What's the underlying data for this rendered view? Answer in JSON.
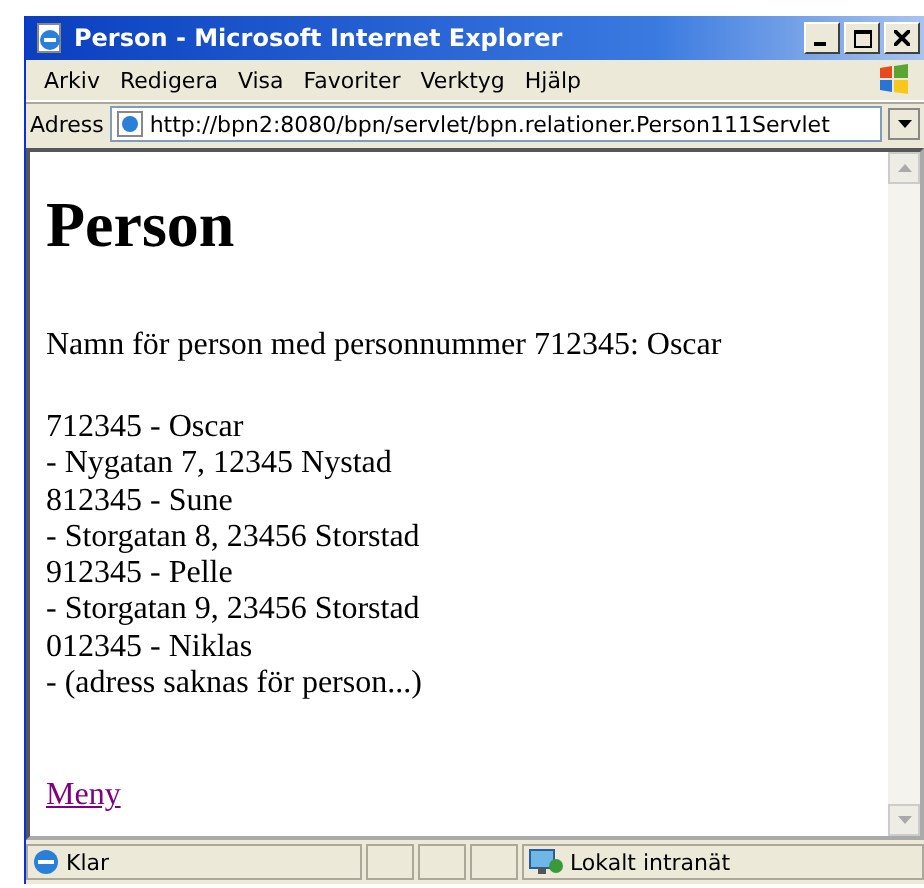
{
  "window": {
    "title": "Person - Microsoft Internet Explorer"
  },
  "menu": [
    "Arkiv",
    "Redigera",
    "Visa",
    "Favoriter",
    "Verktyg",
    "Hjälp"
  ],
  "address": {
    "label": "Adress",
    "value": "http://bpn2:8080/bpn/servlet/bpn.relationer.Person111Servlet"
  },
  "page": {
    "heading": "Person",
    "intro": "Namn för person med personnummer 712345: Oscar",
    "lines": [
      "712345 - Oscar",
      "- Nygatan 7, 12345 Nystad",
      "812345 - Sune",
      "- Storgatan 8, 23456 Storstad",
      "912345 - Pelle",
      "- Storgatan 9, 23456 Storstad",
      "012345 - Niklas",
      "- (adress saknas för person...)"
    ],
    "link": "Meny"
  },
  "status_bar": {
    "status": "Klar",
    "zone": "Lokalt intranät"
  }
}
